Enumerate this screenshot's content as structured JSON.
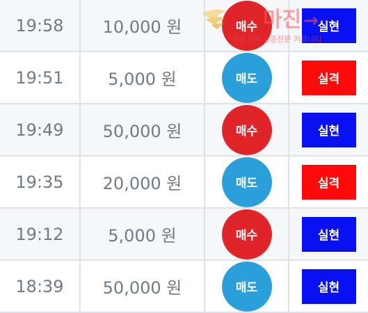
{
  "colors": {
    "buy": "#e0252a",
    "sell": "#2a9fd9",
    "realized": "#0a11f0",
    "failed": "#ff0a0a",
    "stripe": "#f5f7f9"
  },
  "watermark": {
    "title": "마진",
    "subtitle": "마진거래 검증전문 커뮤니티"
  },
  "rows": [
    {
      "time": "19:58",
      "amount": "10,000 원",
      "side": "매수",
      "side_type": "buy",
      "result": "실현",
      "result_type": "realized"
    },
    {
      "time": "19:51",
      "amount": "5,000 원",
      "side": "매도",
      "side_type": "sell",
      "result": "실격",
      "result_type": "failed"
    },
    {
      "time": "19:49",
      "amount": "50,000 원",
      "side": "매수",
      "side_type": "buy",
      "result": "실현",
      "result_type": "realized"
    },
    {
      "time": "19:35",
      "amount": "20,000 원",
      "side": "매도",
      "side_type": "sell",
      "result": "실격",
      "result_type": "failed"
    },
    {
      "time": "19:12",
      "amount": "5,000 원",
      "side": "매수",
      "side_type": "buy",
      "result": "실현",
      "result_type": "realized"
    },
    {
      "time": "18:39",
      "amount": "50,000 원",
      "side": "매도",
      "side_type": "sell",
      "result": "실현",
      "result_type": "realized"
    }
  ]
}
